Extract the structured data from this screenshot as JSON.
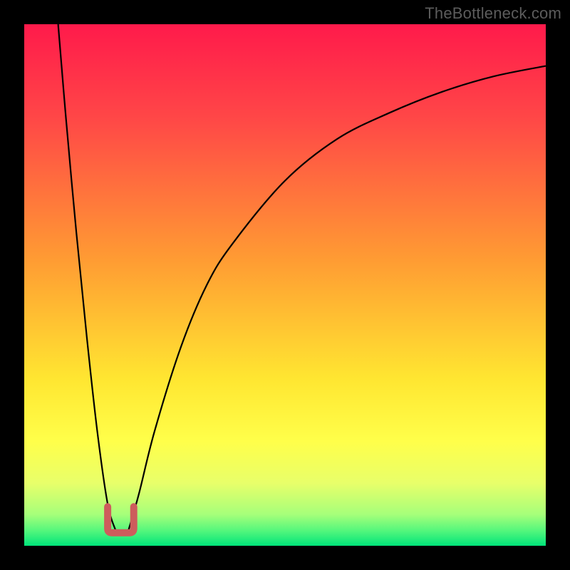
{
  "watermark": "TheBottleneck.com",
  "layout": {
    "image_size": 800,
    "border": 34,
    "plot_size": 732
  },
  "gradient": {
    "stops": [
      {
        "pct": 0,
        "color": "#ff1a4b"
      },
      {
        "pct": 18,
        "color": "#ff4747"
      },
      {
        "pct": 45,
        "color": "#ff9b33"
      },
      {
        "pct": 68,
        "color": "#ffe631"
      },
      {
        "pct": 80,
        "color": "#ffff4a"
      },
      {
        "pct": 88,
        "color": "#e8ff6a"
      },
      {
        "pct": 94,
        "color": "#a6ff7a"
      },
      {
        "pct": 97,
        "color": "#57f77c"
      },
      {
        "pct": 100,
        "color": "#00e47a"
      }
    ]
  },
  "chart_data": {
    "type": "line",
    "title": "",
    "xlabel": "",
    "ylabel": "",
    "xlim": [
      0,
      100
    ],
    "ylim": [
      0,
      100
    ],
    "series": [
      {
        "name": "left-branch",
        "x": [
          6.5,
          8,
          10,
          12,
          14,
          16,
          17.5
        ],
        "y": [
          100,
          82,
          60,
          40,
          22,
          8,
          3
        ],
        "stroke": "#000000",
        "width": 2.2
      },
      {
        "name": "right-branch",
        "x": [
          20,
          22,
          25,
          30,
          35,
          40,
          50,
          60,
          70,
          80,
          90,
          100
        ],
        "y": [
          3,
          10,
          22,
          38,
          50,
          58,
          70,
          78,
          83,
          87,
          90,
          92
        ],
        "stroke": "#000000",
        "width": 2.2
      }
    ],
    "valley_marker": {
      "shape": "u",
      "center_x": 18.5,
      "baseline_y": 2.5,
      "width": 5,
      "height": 5,
      "stroke": "#cd5c5c",
      "stroke_width": 10,
      "linecap": "round"
    }
  }
}
